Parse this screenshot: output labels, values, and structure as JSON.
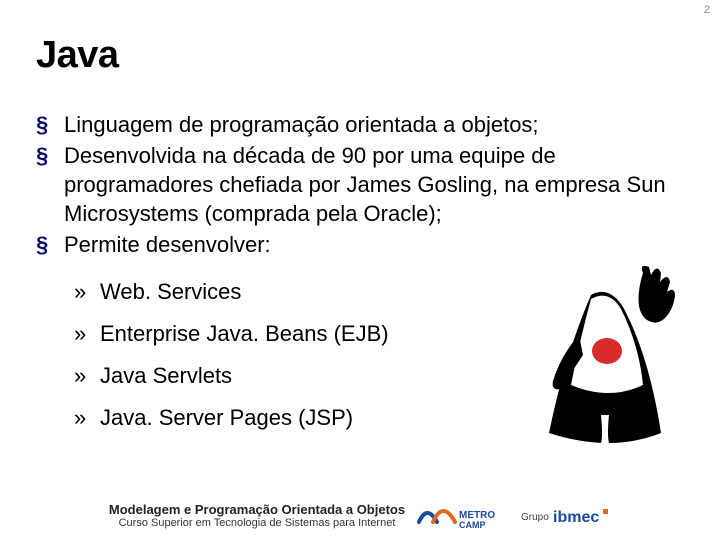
{
  "page_number": "2",
  "title": "Java",
  "bullets": [
    {
      "text": "Linguagem de programação orientada a objetos;"
    },
    {
      "text": "Desenvolvida na década de 90 por uma equipe de programadores chefiada por James Gosling, na empresa Sun Microsystems (comprada pela Oracle);"
    },
    {
      "text": "Permite desenvolver:"
    }
  ],
  "sub_bullets": [
    {
      "text": "Web. Services"
    },
    {
      "text": "Enterprise Java. Beans (EJB)"
    },
    {
      "text": "Java Servlets"
    },
    {
      "text": "Java. Server Pages (JSP)"
    }
  ],
  "footer": {
    "line1": "Modelagem e Programação Orientada a Objetos",
    "line2": "Curso Superior em Tecnologia de Sistemas para Internet",
    "logo1": "METROCAMP",
    "logo2_prefix": "Grupo",
    "logo2_brand": "ibmec"
  },
  "mascot_name": "duke-java-mascot"
}
